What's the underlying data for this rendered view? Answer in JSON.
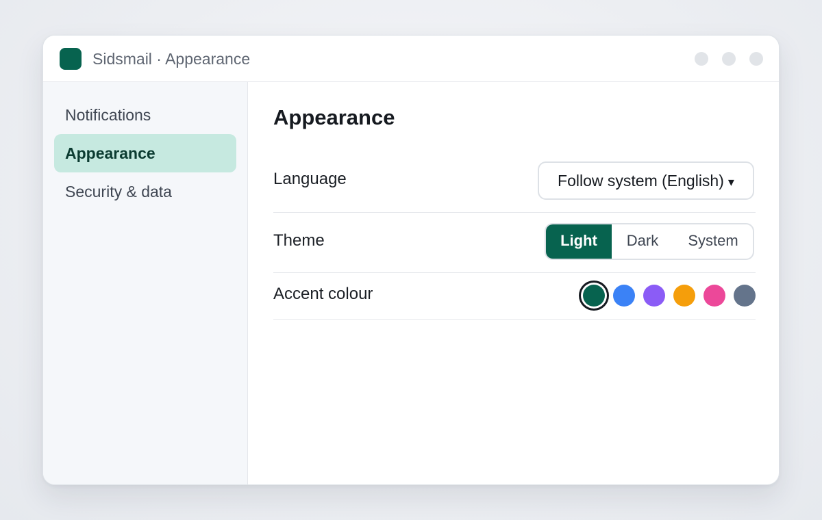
{
  "window": {
    "title": "Sidsmail · Appearance",
    "logo_color": "#07634f",
    "controls": [
      "minimize",
      "maximize",
      "close"
    ]
  },
  "sidebar": {
    "items": [
      {
        "label": "Notifications",
        "active": false
      },
      {
        "label": "Appearance",
        "active": true
      },
      {
        "label": "Security & data",
        "active": false
      }
    ]
  },
  "main": {
    "title": "Appearance",
    "language": {
      "label": "Language",
      "value": "Follow system (English)",
      "caret_icon": "caret-down-icon"
    },
    "theme": {
      "label": "Theme",
      "options": [
        {
          "label": "Light",
          "active": true
        },
        {
          "label": "Dark",
          "active": false
        },
        {
          "label": "System",
          "active": false
        }
      ]
    },
    "accent": {
      "label": "Accent colour",
      "swatches": [
        {
          "name": "green",
          "color": "#07634f",
          "selected": true
        },
        {
          "name": "blue",
          "color": "#3b82f6",
          "selected": false
        },
        {
          "name": "purple",
          "color": "#8b5cf6",
          "selected": false
        },
        {
          "name": "amber",
          "color": "#f59e0b",
          "selected": false
        },
        {
          "name": "pink",
          "color": "#ec4899",
          "selected": false
        },
        {
          "name": "slate",
          "color": "#64748b",
          "selected": false
        }
      ]
    }
  }
}
